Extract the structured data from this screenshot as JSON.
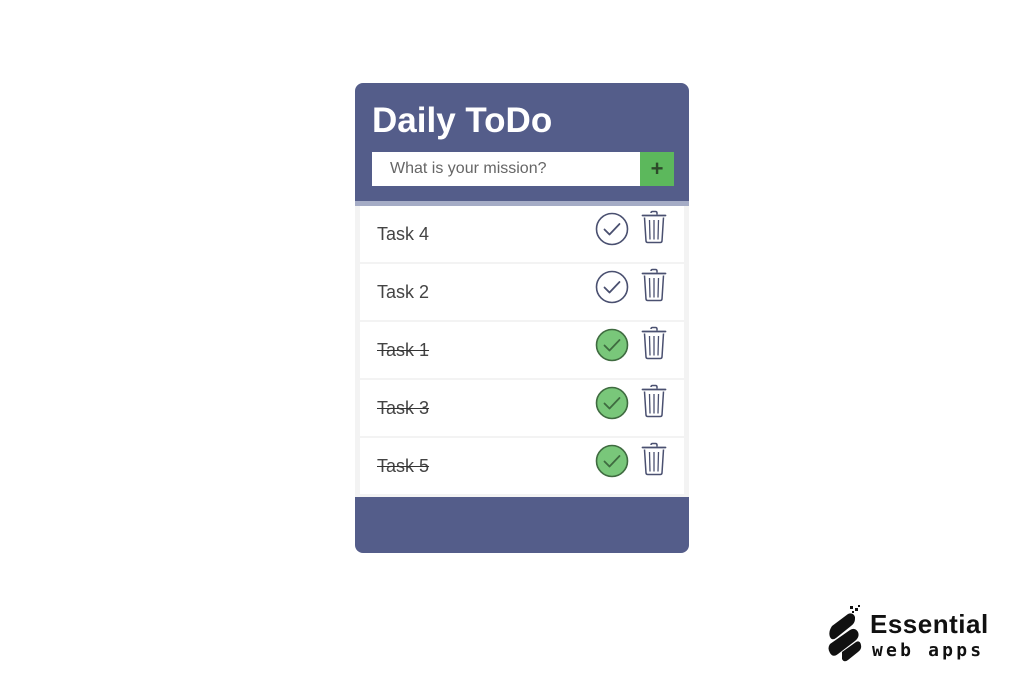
{
  "app": {
    "title": "Daily ToDo",
    "input": {
      "placeholder": "What is your mission?",
      "value": ""
    },
    "add_button": {
      "label": "+",
      "icon": "plus-icon"
    }
  },
  "tasks": [
    {
      "label": "Task 4",
      "done": false
    },
    {
      "label": "Task 2",
      "done": false
    },
    {
      "label": "Task 1",
      "done": true
    },
    {
      "label": "Task 3",
      "done": true
    },
    {
      "label": "Task 5",
      "done": true
    }
  ],
  "icons": {
    "complete": "check-circle-icon",
    "delete": "trash-icon"
  },
  "colors": {
    "panel": "#545d8a",
    "accent_green": "#5cb85c",
    "done_fill": "#79c77a",
    "icon_stroke": "#4a5070"
  },
  "branding": {
    "name": "Essential",
    "tagline": "web apps"
  }
}
